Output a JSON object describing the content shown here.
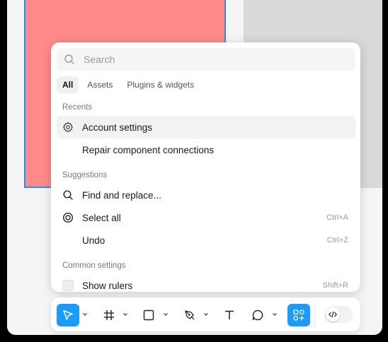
{
  "colors": {
    "accent": "#1a9bff",
    "frame_fill": "#ff8a8a",
    "frame_border": "#1e90ff",
    "frame_grey": "#d9d9d9"
  },
  "search": {
    "placeholder": "Search",
    "value": ""
  },
  "tabs": [
    {
      "label": "All",
      "active": true
    },
    {
      "label": "Assets",
      "active": false
    },
    {
      "label": "Plugins & widgets",
      "active": false
    }
  ],
  "recents": {
    "heading": "Recents",
    "items": [
      {
        "label": "Account settings",
        "icon": "gear-icon",
        "highlighted": true
      },
      {
        "label": "Repair component connections",
        "icon": ""
      }
    ]
  },
  "suggestions": {
    "heading": "Suggestions",
    "items": [
      {
        "label": "Find and replace...",
        "icon": "search-icon",
        "shortcut": ""
      },
      {
        "label": "Select all",
        "icon": "target-icon",
        "shortcut": "Ctrl+A"
      },
      {
        "label": "Undo",
        "icon": "",
        "shortcut": "Ctrl+Z"
      }
    ]
  },
  "common_settings": {
    "heading": "Common settings",
    "items": [
      {
        "label": "Show rulers",
        "icon": "checkbox",
        "shortcut": "Shift+R"
      }
    ]
  },
  "toolbar": {
    "tools": [
      {
        "name": "move-tool",
        "icon": "cursor-icon",
        "active": true
      },
      {
        "name": "frame-tool",
        "icon": "hash-icon"
      },
      {
        "name": "shape-tool",
        "icon": "square-icon"
      },
      {
        "name": "pen-tool",
        "icon": "pen-icon"
      },
      {
        "name": "text-tool",
        "icon": "text-icon"
      },
      {
        "name": "comment-tool",
        "icon": "comment-icon"
      },
      {
        "name": "actions-tool",
        "icon": "actions-icon",
        "active": true
      }
    ],
    "dev_mode": {
      "icon": "code-icon",
      "on": false
    }
  }
}
